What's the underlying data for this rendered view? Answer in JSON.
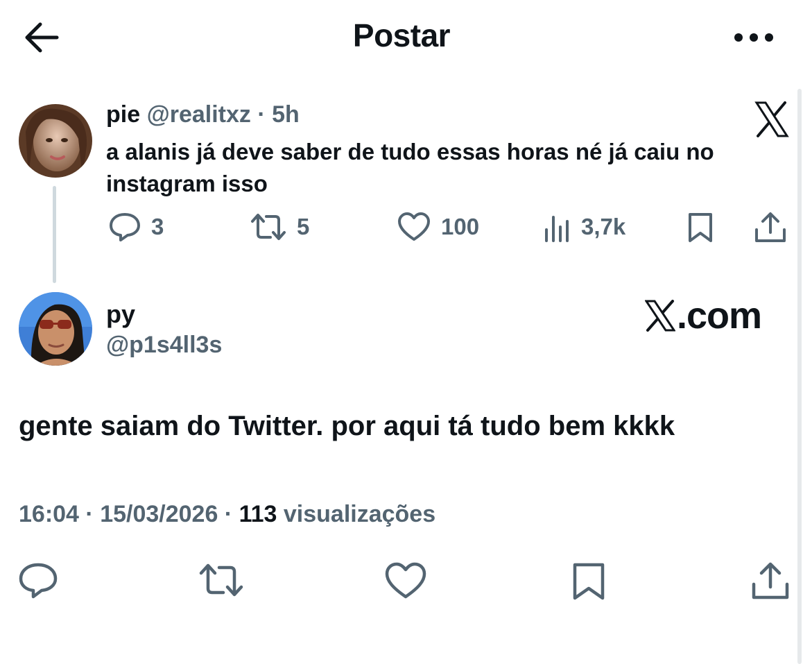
{
  "header": {
    "title": "Postar",
    "back_icon": "arrow-left-icon",
    "more_icon": "more-horizontal-icon"
  },
  "quoted_tweet": {
    "name": "pie",
    "handle": "@realitxz",
    "separator": "·",
    "time": "5h",
    "text": "a alanis já deve saber de tudo essas horas né já caiu no instagram isso",
    "replies": "3",
    "retweets": "5",
    "likes": "100",
    "views": "3,7k",
    "brand_icon": "x-logo-icon"
  },
  "main_tweet": {
    "name": "py",
    "handle": "@p1s4ll3s",
    "brand_text": ".com",
    "text": "gente saiam do Twitter. por aqui tá tudo bem kkkk",
    "time": "16:04",
    "sep1": " · ",
    "date": "15/03/2026",
    "sep2": " · ",
    "views_count": "113",
    "views_label": " visualizações"
  },
  "colors": {
    "text_primary": "#0f1419",
    "text_secondary": "#536471",
    "thread_line": "#cfd9de",
    "background": "#ffffff"
  }
}
